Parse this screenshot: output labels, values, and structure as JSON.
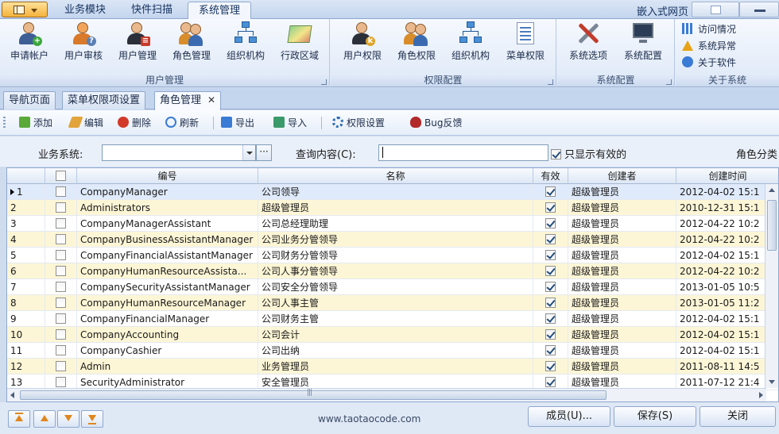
{
  "ribbon_tabs": [
    {
      "label": "业务模块"
    },
    {
      "label": "快件扫描"
    },
    {
      "label": "系统管理"
    }
  ],
  "embed_label": "嵌入式网页",
  "groups": {
    "user_mgmt": {
      "label": "用户管理",
      "buttons": [
        "申请帐户",
        "用户审核",
        "用户管理",
        "角色管理",
        "组织机构",
        "行政区域"
      ]
    },
    "permission": {
      "label": "权限配置",
      "buttons": [
        "用户权限",
        "角色权限",
        "组织机构",
        "菜单权限"
      ]
    },
    "sys_config": {
      "label": "系统配置",
      "buttons": [
        "系统选项",
        "系统配置"
      ]
    },
    "about": {
      "label": "关于系统",
      "buttons": [
        "访问情况",
        "系统异常",
        "关于软件"
      ]
    }
  },
  "doc_tabs": [
    "导航页面",
    "菜单权限项设置",
    "角色管理"
  ],
  "toolbar": [
    "添加",
    "编辑",
    "删除",
    "刷新",
    "导出",
    "导入",
    "权限设置",
    "Bug反馈"
  ],
  "filter": {
    "business_label": "业务系统:",
    "business_value": "",
    "ellipsis": "···",
    "query_label": "查询内容(C):",
    "query_value": "",
    "only_valid_label": "只显示有效的",
    "only_valid_checked": true,
    "role_category_label": "角色分类"
  },
  "grid": {
    "columns": [
      "",
      "",
      "编号",
      "名称",
      "有效",
      "创建者",
      "创建时间"
    ],
    "rows": [
      {
        "no": "1",
        "code": "CompanyManager",
        "name": "公司领导",
        "valid": true,
        "creator": "超级管理员",
        "created": "2012-04-02 15:1"
      },
      {
        "no": "2",
        "code": "Administrators",
        "name": "超级管理员",
        "valid": true,
        "creator": "超级管理员",
        "created": "2010-12-31 15:1"
      },
      {
        "no": "3",
        "code": "CompanyManagerAssistant",
        "name": "公司总经理助理",
        "valid": true,
        "creator": "超级管理员",
        "created": "2012-04-22 10:2"
      },
      {
        "no": "4",
        "code": "CompanyBusinessAssistantManager",
        "name": "公司业务分管领导",
        "valid": true,
        "creator": "超级管理员",
        "created": "2012-04-22 10:2"
      },
      {
        "no": "5",
        "code": "CompanyFinancialAssistantManager",
        "name": "公司财务分管领导",
        "valid": true,
        "creator": "超级管理员",
        "created": "2012-04-02 15:1"
      },
      {
        "no": "6",
        "code": "CompanyHumanResourceAssista...",
        "name": "公司人事分管领导",
        "valid": true,
        "creator": "超级管理员",
        "created": "2012-04-22 10:2"
      },
      {
        "no": "7",
        "code": "CompanySecurityAssistantManager",
        "name": "公司安全分管领导",
        "valid": true,
        "creator": "超级管理员",
        "created": "2013-01-05 10:5"
      },
      {
        "no": "8",
        "code": "CompanyHumanResourceManager",
        "name": "公司人事主管",
        "valid": true,
        "creator": "超级管理员",
        "created": "2013-01-05 11:2"
      },
      {
        "no": "9",
        "code": "CompanyFinancialManager",
        "name": "公司财务主管",
        "valid": true,
        "creator": "超级管理员",
        "created": "2012-04-02 15:1"
      },
      {
        "no": "10",
        "code": "CompanyAccounting",
        "name": "公司会计",
        "valid": true,
        "creator": "超级管理员",
        "created": "2012-04-02 15:1"
      },
      {
        "no": "11",
        "code": "CompanyCashier",
        "name": "公司出纳",
        "valid": true,
        "creator": "超级管理员",
        "created": "2012-04-02 15:1"
      },
      {
        "no": "12",
        "code": "Admin",
        "name": "业务管理员",
        "valid": true,
        "creator": "超级管理员",
        "created": "2011-08-11 14:5"
      },
      {
        "no": "13",
        "code": "SecurityAdministrator",
        "name": "安全管理员",
        "valid": true,
        "creator": "超级管理员",
        "created": "2011-07-12 21:4"
      }
    ]
  },
  "footer_note": "www.taotaocode.com",
  "dialog_buttons": [
    "成员(U)...",
    "保存(S)",
    "关闭"
  ],
  "colors": {
    "alt_row": "#fdf6d6",
    "selected_row": "#dfeafb",
    "ribbon_bg": "#dde8f7"
  }
}
